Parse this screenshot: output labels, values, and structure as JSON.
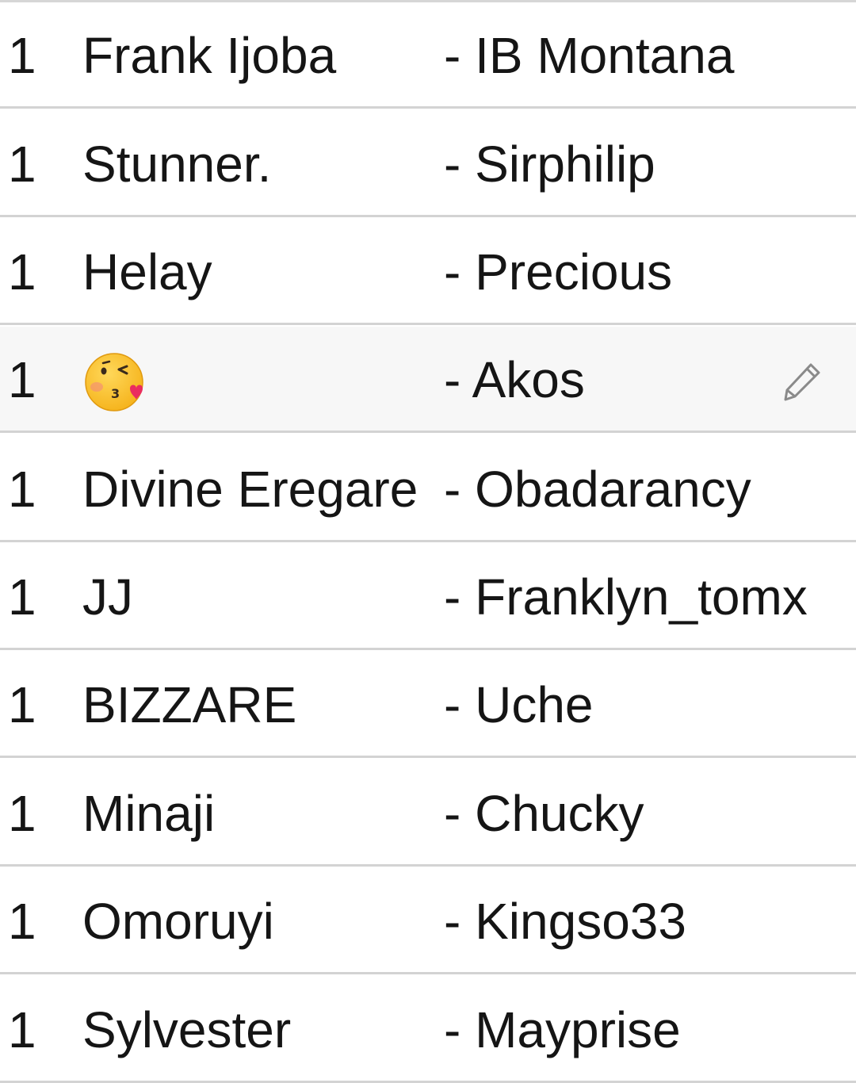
{
  "rows": [
    {
      "qty": "1",
      "name": "Frank Ijoba",
      "partner": "- IB Montana"
    },
    {
      "qty": "1",
      "name": "Stunner.",
      "partner": "- Sirphilip"
    },
    {
      "qty": "1",
      "name": "Helay",
      "partner": "- Precious"
    },
    {
      "qty": "1",
      "name": "",
      "name_icon": "kissing-face-icon",
      "partner": "- Akos",
      "action_icon": "pencil-edit-icon"
    },
    {
      "qty": "1",
      "name": "Divine Eregare",
      "partner": "- Obadarancy"
    },
    {
      "qty": "1",
      "name": "JJ",
      "partner": "- Franklyn_tomx"
    },
    {
      "qty": "1",
      "name": "BIZZARE",
      "partner": "- Uche"
    },
    {
      "qty": "1",
      "name": "Minaji",
      "partner": "- Chucky"
    },
    {
      "qty": "1",
      "name": "Omoruyi",
      "partner": "- Kingso33"
    },
    {
      "qty": "1",
      "name": "Sylvester",
      "partner": "- Mayprise"
    }
  ],
  "colors": {
    "text": "#151515",
    "divider": "#d3d3d3",
    "selected_row": "#f7f7f7",
    "emoji_face": "#fbc12b",
    "emoji_heart": "#ea2d5f"
  }
}
